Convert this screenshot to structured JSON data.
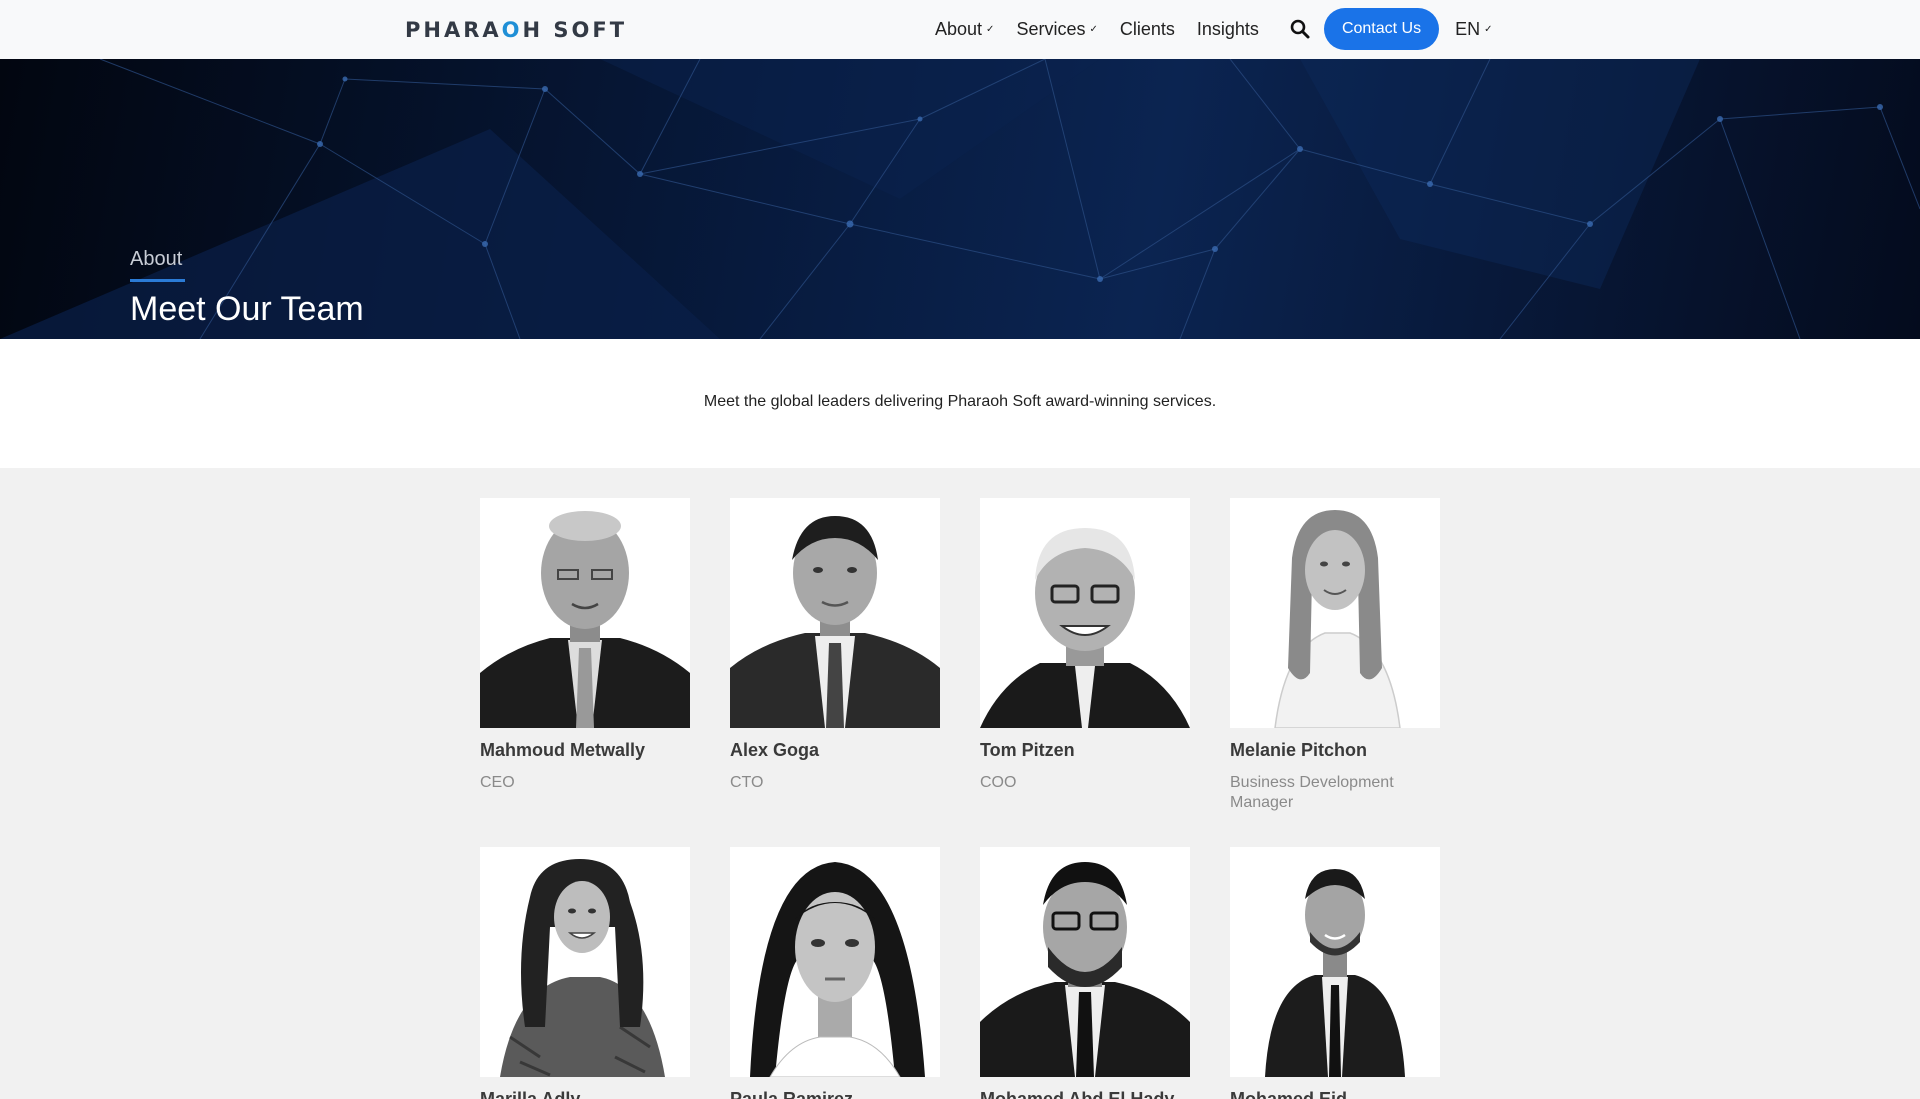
{
  "nav": {
    "logo_part1": "PHARA",
    "logo_accent": "O",
    "logo_part2": "H SOFT",
    "items": [
      {
        "label": "About",
        "dropdown": true
      },
      {
        "label": "Services",
        "dropdown": true
      },
      {
        "label": "Clients",
        "dropdown": false
      },
      {
        "label": "Insights",
        "dropdown": false
      }
    ],
    "search_icon": "search-icon",
    "contact_label": "Contact Us",
    "lang_label": "EN"
  },
  "hero": {
    "eyebrow": "About",
    "title": "Meet Our Team"
  },
  "intro": {
    "text": "Meet the global leaders delivering Pharaoh Soft award-winning services."
  },
  "team": [
    {
      "name": "Mahmoud Metwally",
      "role": "CEO"
    },
    {
      "name": "Alex Goga",
      "role": "CTO"
    },
    {
      "name": "Tom Pitzen",
      "role": "COO"
    },
    {
      "name": "Melanie Pitchon",
      "role": "Business Development Manager"
    },
    {
      "name": "Marilla Adly",
      "role": ""
    },
    {
      "name": "Paula Ramirez",
      "role": ""
    },
    {
      "name": "Mohamed Abd El Hady",
      "role": ""
    },
    {
      "name": "Mohamed Eid",
      "role": ""
    }
  ],
  "colors": {
    "accent": "#1a73e8",
    "hero_dark": "#020610",
    "hero_blue": "#0b2451"
  }
}
